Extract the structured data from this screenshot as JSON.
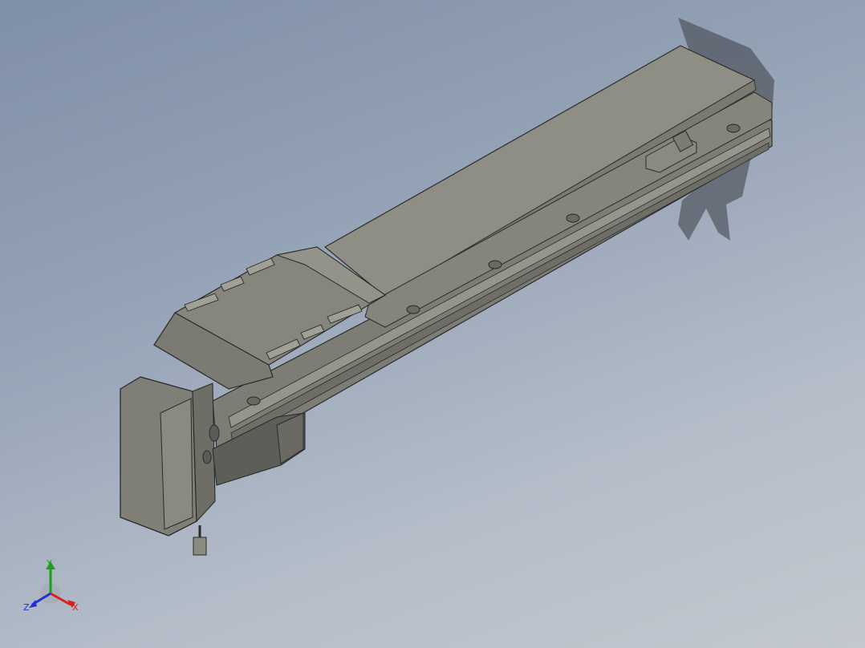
{
  "viewport": {
    "background_top": "#7f8fa6",
    "background_bottom": "#c3c8cf"
  },
  "model": {
    "description_icon": "linear-actuator-3d-model",
    "body_color": "#8e8e84",
    "edge_color": "#2b2b2b"
  },
  "triad": {
    "x_label": "X",
    "y_label": "Y",
    "z_label": "Z",
    "x_color": "#d42020",
    "y_color": "#1aa01a",
    "z_color": "#2030d0"
  }
}
